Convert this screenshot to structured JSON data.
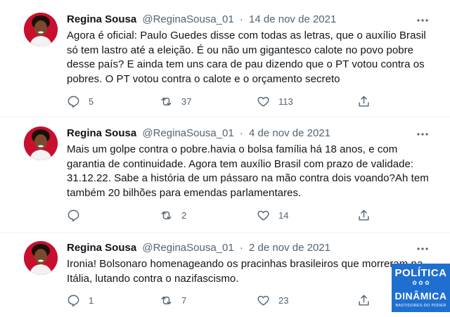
{
  "tweets": [
    {
      "name": "Regina Sousa",
      "handle": "@ReginaSousa_01",
      "sep": "·",
      "date": "14 de nov de 2021",
      "lines": [
        "Agora é oficial: Paulo Guedes disse com todas as letras, que o auxílio Brasil",
        "só tem lastro até a eleição. É ou não um gigantesco calote no povo pobre",
        "desse país? E ainda tem uns cara de pau dizendo que o PT votou contra os",
        "pobres. O PT votou contra o calote e o orçamento secreto"
      ],
      "replies": "5",
      "retweets": "37",
      "likes": "113"
    },
    {
      "name": "Regina Sousa",
      "handle": "@ReginaSousa_01",
      "sep": "·",
      "date": "4 de nov de 2021",
      "lines": [
        "Mais um golpe contra o pobre.havia o bolsa família há 18 anos, e com",
        "garantia de continuidade. Agora tem auxílio Brasil com prazo de validade:",
        "31.12.22. Sabe a história de um pássaro na mão contra dois voando?Ah tem",
        "também 20 bilhões para emendas parlamentares."
      ],
      "replies": "",
      "retweets": "2",
      "likes": "14"
    },
    {
      "name": "Regina Sousa",
      "handle": "@ReginaSousa_01",
      "sep": "·",
      "date": "2 de nov de 2021",
      "lines": [
        "Ironia! Bolsonaro homenageando os pracinhas brasileiros que morreram na",
        "Itália, lutando contra o nazifascismo."
      ],
      "replies": "1",
      "retweets": "7",
      "likes": "23"
    }
  ],
  "watermark": {
    "line1": "POLÍTICA",
    "line2": "DINÂMICA",
    "tagline": "BASTIDORES DO PODER",
    "ornament": "✿ ✿ ✿"
  },
  "colors": {
    "text": "#0f1419",
    "muted": "#536471",
    "divider": "#eff3f4",
    "avatar_bg": "#c8102e",
    "logo_bg": "#1f6fd1"
  }
}
